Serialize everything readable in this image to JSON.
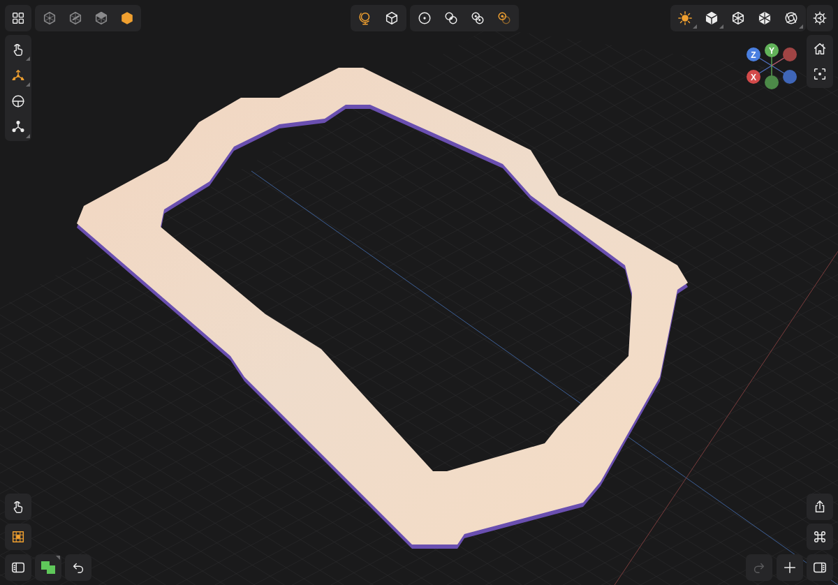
{
  "view_modes": [
    {
      "selected": false
    },
    {
      "selected": false
    },
    {
      "selected": false
    },
    {
      "selected": true
    }
  ],
  "left_tools": [
    {
      "selected": false,
      "submenu": true
    },
    {
      "selected": true,
      "submenu": true
    },
    {
      "selected": false,
      "submenu": false
    },
    {
      "selected": false,
      "submenu": true
    }
  ],
  "camera_tools": [
    {
      "selected": true
    },
    {
      "selected": false
    }
  ],
  "selection_tools": [
    {
      "selected": false
    },
    {
      "selected": false
    },
    {
      "selected": false
    },
    {
      "selected": true
    }
  ],
  "display_tools": [
    {
      "selected": true,
      "submenu": true
    },
    {
      "selected": false,
      "submenu": true
    },
    {
      "selected": false,
      "submenu": false
    },
    {
      "selected": false,
      "submenu": false
    },
    {
      "selected": false,
      "submenu": true
    }
  ],
  "gizmo": {
    "labels": [
      "Z",
      "Y",
      "X"
    ]
  },
  "bottom_left": [
    {
      "selected": false
    },
    {
      "selected": true
    }
  ],
  "color_button": {
    "submenu": true
  },
  "redo": {
    "disabled": true
  }
}
